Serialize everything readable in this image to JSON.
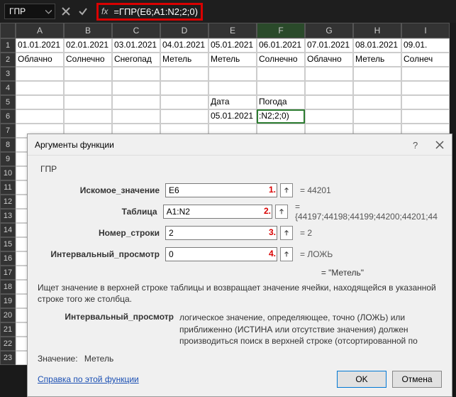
{
  "topbar": {
    "name_box": "ГПР",
    "formula": "=ГПР(E6;A1:N2;2;0)"
  },
  "sheet": {
    "columns": [
      "A",
      "B",
      "C",
      "D",
      "E",
      "F",
      "G",
      "H",
      "I"
    ],
    "row1": [
      "01.01.2021",
      "02.01.2021",
      "03.01.2021",
      "04.01.2021",
      "05.01.2021",
      "06.01.2021",
      "07.01.2021",
      "08.01.2021",
      "09.01."
    ],
    "row2": [
      "Облачно",
      "Солнечно",
      "Снегопад",
      "Метель",
      "Метель",
      "Солнечно",
      "Облачно",
      "Метель",
      "Солнеч"
    ],
    "E5": "Дата",
    "F5": "Погода",
    "E6": "05.01.2021",
    "F6": ":N2;2;0)",
    "rows_visible": 23
  },
  "dialog": {
    "title": "Аргументы функции",
    "func": "ГПР",
    "args": {
      "a1": {
        "label": "Искомое_значение",
        "value": "E6",
        "badge": "1.",
        "result": "= 44201"
      },
      "a2": {
        "label": "Таблица",
        "value": "A1:N2",
        "badge": "2.",
        "result": "= {44197;44198;44199;44200;44201;44"
      },
      "a3": {
        "label": "Номер_строки",
        "value": "2",
        "badge": "3.",
        "result": "= 2"
      },
      "a4": {
        "label": "Интервальный_просмотр",
        "value": "0",
        "badge": "4.",
        "result": "= ЛОЖЬ"
      }
    },
    "eq_result": "= \"Метель\"",
    "desc_main": "Ищет значение в верхней строке таблицы и возвращает значение ячейки, находящейся в указанной строке того же столбца.",
    "param_name": "Интервальный_просмотр",
    "param_desc": "логическое значение, определяющее, точно (ЛОЖЬ) или приближенно (ИСТИНА или отсутствие значения) должен производиться поиск в верхней строке (отсортированной по",
    "value_label": "Значение:",
    "value_text": "Метель",
    "help_link": "Справка по этой функции",
    "ok": "OK",
    "cancel": "Отмена"
  }
}
